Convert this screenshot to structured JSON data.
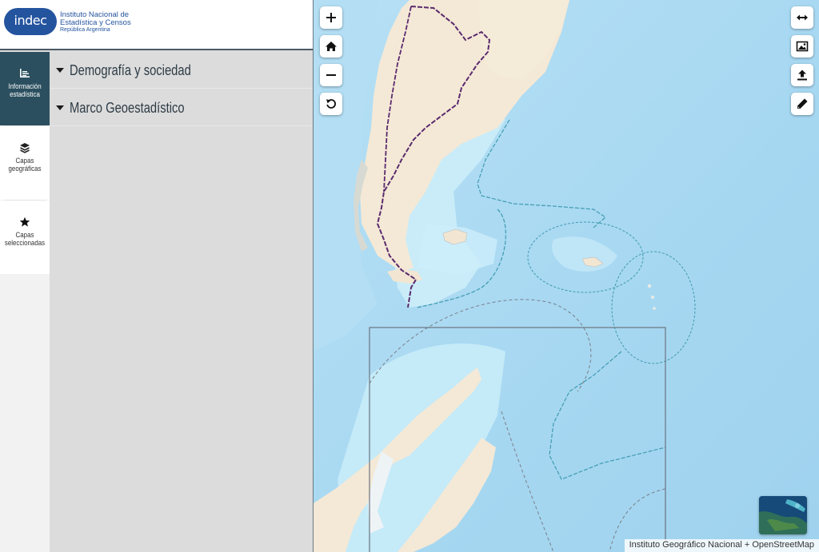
{
  "logo": {
    "pill_text": "indec",
    "line1": "Instituto Nacional de",
    "line2": "Estadística y Censos",
    "line3": "República Argentina"
  },
  "sidebar": {
    "items": [
      {
        "label_line1": "Información",
        "label_line2": "estadística",
        "icon": "bar-chart-icon",
        "active": true
      },
      {
        "label_line1": "Capas",
        "label_line2": "geográficas",
        "icon": "layers-icon",
        "active": false
      },
      {
        "label_line1": "Capas",
        "label_line2": "seleccionadas",
        "icon": "star-icon",
        "active": false
      }
    ]
  },
  "menu": {
    "sections": [
      {
        "label": "Demografía y sociedad"
      },
      {
        "label": "Marco Geoestadístico"
      }
    ]
  },
  "map": {
    "controls_left": [
      {
        "name": "zoom-in-button",
        "icon": "plus-icon",
        "glyph": "+"
      },
      {
        "name": "home-button",
        "icon": "home-icon"
      },
      {
        "name": "zoom-out-button",
        "icon": "minus-icon",
        "glyph": "−"
      },
      {
        "name": "reset-rotation-button",
        "icon": "rotate-icon"
      }
    ],
    "controls_right": [
      {
        "name": "measure-button",
        "icon": "horizontal-arrows-icon"
      },
      {
        "name": "export-image-button",
        "icon": "image-icon"
      },
      {
        "name": "upload-button",
        "icon": "upload-icon"
      },
      {
        "name": "draw-button",
        "icon": "pencil-icon"
      }
    ],
    "attribution": "Instituto Geográfico Nacional + OpenStreetMap",
    "colors": {
      "ocean": "#a9d9f2",
      "shelf": "#c8ebf7",
      "land": "#f5ead7",
      "boundary": "#5a2a6e",
      "eez": "#3f9bb0"
    }
  }
}
